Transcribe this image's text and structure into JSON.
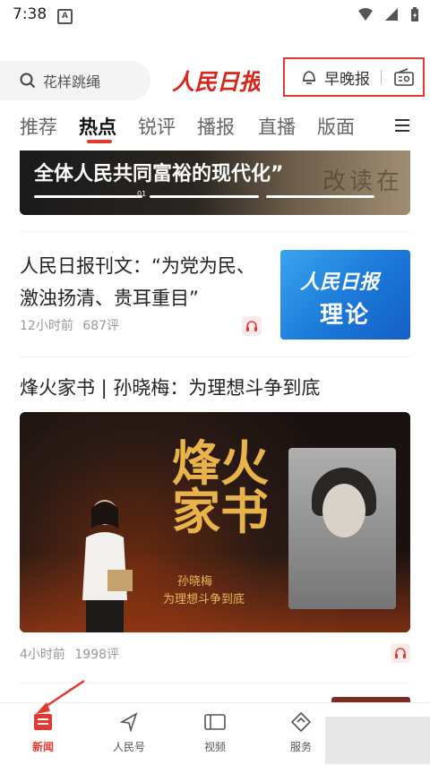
{
  "status": {
    "time": "7:38",
    "app_indicator": "A"
  },
  "search": {
    "placeholder": "花样跳绳"
  },
  "brand": {
    "logo": "人民日报"
  },
  "header_actions": {
    "morning_evening": "早晚报"
  },
  "tabs": [
    {
      "label": "推荐"
    },
    {
      "label": "热点"
    },
    {
      "label": "锐评"
    },
    {
      "label": "播报"
    },
    {
      "label": "直播"
    },
    {
      "label": "版面"
    }
  ],
  "active_tab": "热点",
  "banner": {
    "title": "全体人民共同富裕的现代化”",
    "page": "01",
    "bg_text": "改读在"
  },
  "article1": {
    "title": "人民日报刊文：“为党为民、激浊扬清、贵耳重目”",
    "time": "12小时前",
    "comments": "687评",
    "thumb_logo": "人民日报",
    "thumb_label": "理论"
  },
  "article2": {
    "title": "烽火家书 | 孙晓梅：为理想斗争到底",
    "image_title": "烽火家书",
    "image_sub1": "孙晓梅",
    "image_sub2": "为理想斗争到底",
    "time": "4小时前",
    "comments": "1998评"
  },
  "bottom_nav": [
    {
      "label": "新闻"
    },
    {
      "label": "人民号"
    },
    {
      "label": "视频"
    },
    {
      "label": "服务"
    }
  ],
  "colors": {
    "accent": "#e23a2e",
    "thumb_blue": "#1a78d8"
  }
}
